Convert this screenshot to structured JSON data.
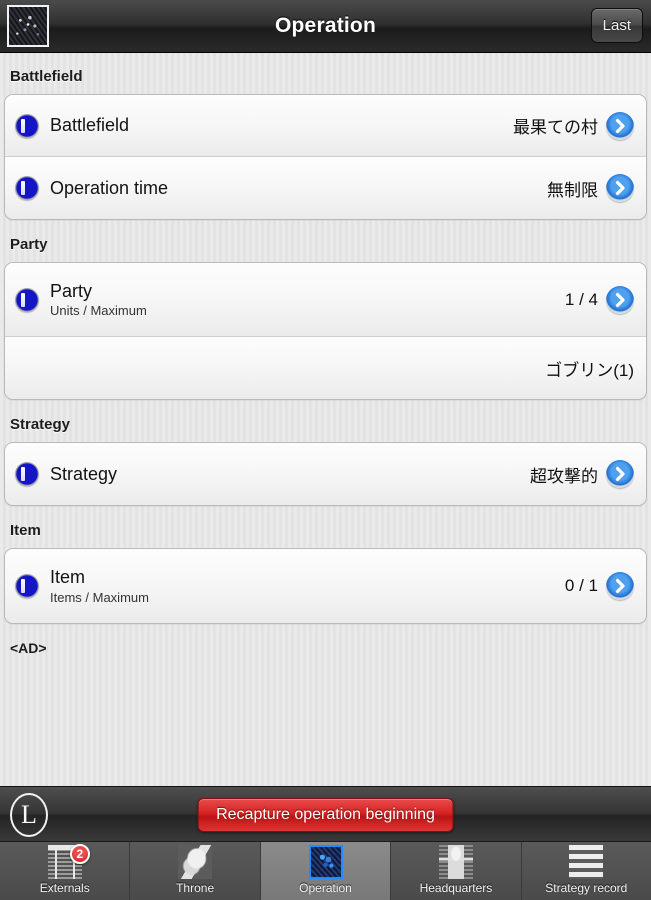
{
  "header": {
    "title": "Operation",
    "thumb_icon": "map-thumbnail-icon",
    "last_button": "Last"
  },
  "sections": [
    {
      "title": "Battlefield",
      "rows": [
        {
          "icon": "info-circle-icon",
          "label": "Battlefield",
          "sub": "",
          "value": "最果ての村",
          "chevron": true
        },
        {
          "icon": "info-circle-icon",
          "label": "Operation time",
          "sub": "",
          "value": "無制限",
          "chevron": true
        }
      ]
    },
    {
      "title": "Party",
      "rows": [
        {
          "icon": "info-circle-icon",
          "label": "Party",
          "sub": "Units / Maximum",
          "value": "1 / 4",
          "chevron": true
        },
        {
          "icon": "",
          "label": "",
          "sub": "",
          "value": "ゴブリン(1)",
          "chevron": false
        }
      ]
    },
    {
      "title": "Strategy",
      "rows": [
        {
          "icon": "info-circle-icon",
          "label": "Strategy",
          "sub": "",
          "value": "超攻撃的",
          "chevron": true
        }
      ]
    },
    {
      "title": "Item",
      "rows": [
        {
          "icon": "info-circle-icon",
          "label": "Item",
          "sub": "Items / Maximum",
          "value": "0 / 1",
          "chevron": true
        }
      ]
    }
  ],
  "ad_label": "<AD>",
  "action_bar": {
    "logo_letter": "L",
    "button_label": "Recapture operation beginning"
  },
  "tabs": [
    {
      "label": "Externals",
      "icon": "gate-icon",
      "active": false,
      "badge": "2"
    },
    {
      "label": "Throne",
      "icon": "horse-icon",
      "active": false,
      "badge": ""
    },
    {
      "label": "Operation",
      "icon": "map-icon",
      "active": true,
      "badge": ""
    },
    {
      "label": "Headquarters",
      "icon": "castle-icon",
      "active": false,
      "badge": ""
    },
    {
      "label": "Strategy record",
      "icon": "records-icon",
      "active": false,
      "badge": ""
    }
  ]
}
